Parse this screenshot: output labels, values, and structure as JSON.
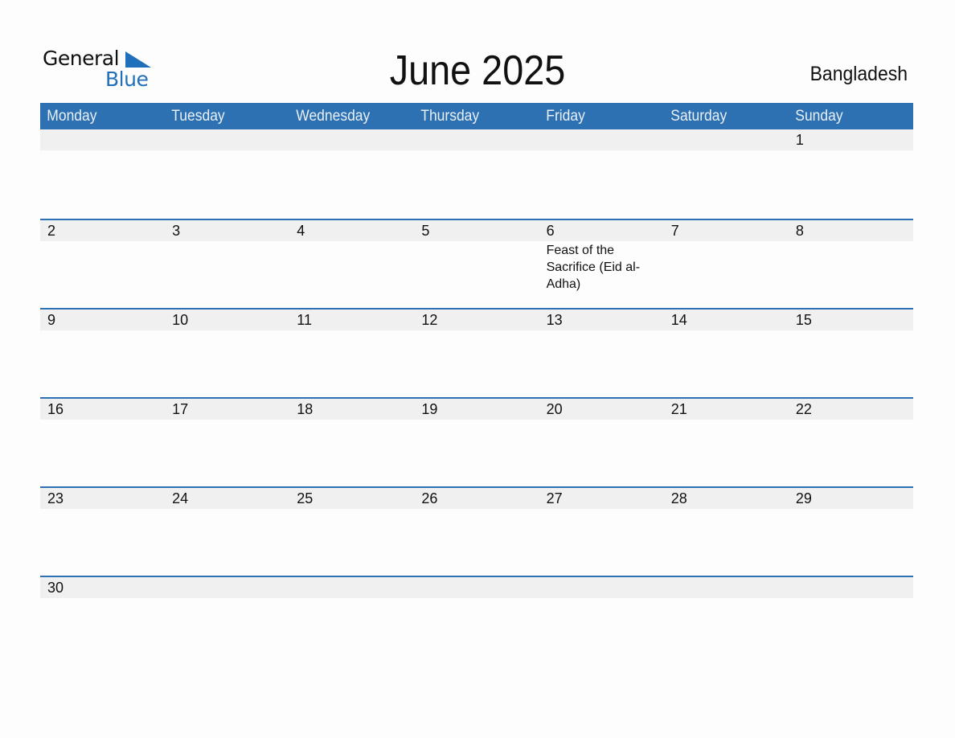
{
  "logo": {
    "line1": "General",
    "line2": "Blue"
  },
  "title": "June 2025",
  "country": "Bangladesh",
  "colors": {
    "accent": "#2d71b3",
    "band": "#f0f0f0",
    "logo_blue": "#1f6fba"
  },
  "weekdays": [
    "Monday",
    "Tuesday",
    "Wednesday",
    "Thursday",
    "Friday",
    "Saturday",
    "Sunday"
  ],
  "weeks": [
    {
      "days": [
        {
          "n": ""
        },
        {
          "n": ""
        },
        {
          "n": ""
        },
        {
          "n": ""
        },
        {
          "n": ""
        },
        {
          "n": ""
        },
        {
          "n": "1"
        }
      ]
    },
    {
      "days": [
        {
          "n": "2"
        },
        {
          "n": "3"
        },
        {
          "n": "4"
        },
        {
          "n": "5"
        },
        {
          "n": "6",
          "event": "Feast of the Sacrifice (Eid al-Adha)"
        },
        {
          "n": "7"
        },
        {
          "n": "8"
        }
      ]
    },
    {
      "days": [
        {
          "n": "9"
        },
        {
          "n": "10"
        },
        {
          "n": "11"
        },
        {
          "n": "12"
        },
        {
          "n": "13"
        },
        {
          "n": "14"
        },
        {
          "n": "15"
        }
      ]
    },
    {
      "days": [
        {
          "n": "16"
        },
        {
          "n": "17"
        },
        {
          "n": "18"
        },
        {
          "n": "19"
        },
        {
          "n": "20"
        },
        {
          "n": "21"
        },
        {
          "n": "22"
        }
      ]
    },
    {
      "days": [
        {
          "n": "23"
        },
        {
          "n": "24"
        },
        {
          "n": "25"
        },
        {
          "n": "26"
        },
        {
          "n": "27"
        },
        {
          "n": "28"
        },
        {
          "n": "29"
        }
      ]
    },
    {
      "days": [
        {
          "n": "30"
        },
        {
          "n": ""
        },
        {
          "n": ""
        },
        {
          "n": ""
        },
        {
          "n": ""
        },
        {
          "n": ""
        },
        {
          "n": ""
        }
      ]
    }
  ]
}
